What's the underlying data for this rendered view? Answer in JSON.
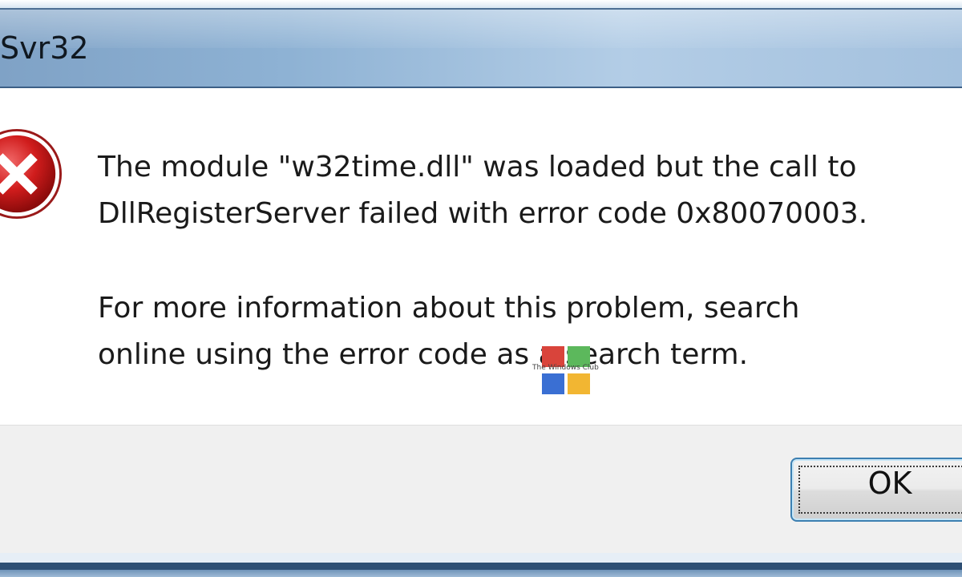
{
  "window": {
    "title": "Svr32"
  },
  "message": {
    "line1": "The module \"w32time.dll\" was loaded but the call to",
    "line2": "DllRegisterServer failed with error code 0x80070003.",
    "line3": "For more information about this problem, search",
    "line4": "online using the error code as a search term."
  },
  "icon": {
    "name": "error-icon",
    "color": "#d01c1c"
  },
  "watermark": {
    "text": "The Windows Club"
  },
  "buttons": {
    "ok_label": "OK"
  },
  "colors": {
    "titlebar": "#8eb2d4",
    "footer": "#f0f0f0",
    "button_border": "#3c7fb1"
  }
}
